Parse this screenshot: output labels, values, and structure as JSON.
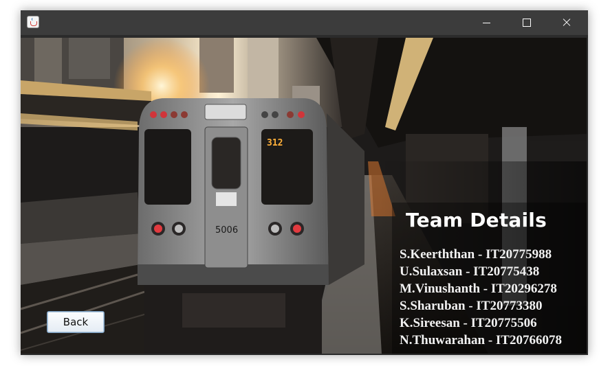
{
  "window": {
    "title": "",
    "controls": [
      "minimize",
      "maximize",
      "close"
    ]
  },
  "content": {
    "heading": "Team Details",
    "members": [
      "S.Keerththan - IT20775988",
      "U.Sulaxsan - IT20775438",
      "M.Vinushanth - IT20296278",
      "S.Sharuban - IT20773380",
      "K.Sireesan - IT20775506",
      "N.Thuwarahan - IT20766078"
    ],
    "back_label": "Back",
    "train_number": "5006",
    "train_route": "312"
  },
  "colors": {
    "titlebar": "#3c3c3c",
    "heading_text": "#ffffff",
    "member_text": "#f2f2f2"
  }
}
